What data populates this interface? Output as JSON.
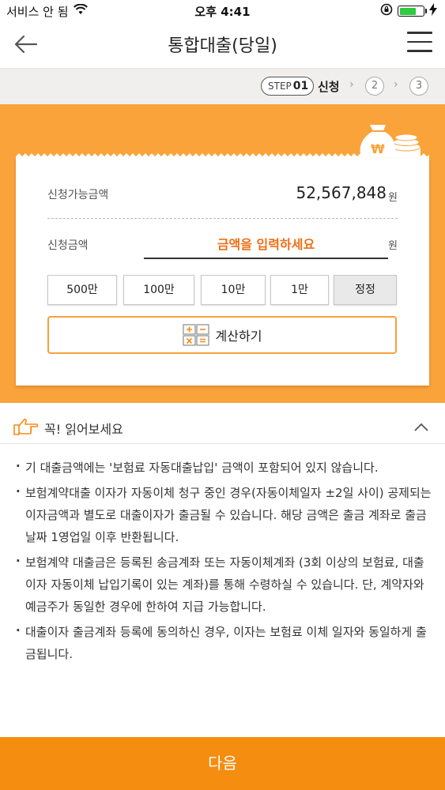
{
  "status_bar": {
    "carrier": "서비스 안 됨",
    "time": "오후 4:41"
  },
  "header": {
    "title": "통합대출(당일)"
  },
  "steps": {
    "step_prefix": "STEP",
    "current_number": "01",
    "current_label": "신청",
    "step2": "2",
    "step3": "3"
  },
  "form": {
    "available_label": "신청가능금액",
    "available_amount": "52,567,848",
    "available_unit": "원",
    "apply_label": "신청금액",
    "apply_placeholder": "금액을 입력하세요",
    "apply_unit": "원",
    "amount_buttons": [
      "500만",
      "100만",
      "10만",
      "1만",
      "정정"
    ],
    "calc_label": "계산하기"
  },
  "notice": {
    "title": "꼭! 읽어보세요",
    "items": [
      "기 대출금액에는 '보험료 자동대출납입' 금액이 포함되어 있지 않습니다.",
      "보험계약대출 이자가 자동이체 청구 중인 경우(자동이체일자 ±2일 사이) 공제되는 이자금액과 별도로 대출이자가 출금될 수 있습니다. 해당 금액은 출금 계좌로 출금날짜 1영업일 이후 반환됩니다.",
      "보험계약 대출금은 등록된 송금계좌 또는 자동이체계좌 (3회 이상의 보험료, 대출이자 자동이체 납입기록이 있는 계좌)를 통해 수령하실 수 있습니다. 단, 계약자와 예금주가 동일한 경우에 한하여 지급 가능합니다.",
      "대출이자 출금계좌 등록에 동의하신 경우, 이자는 보험료 이체 일자와 동일하게 출금됩니다."
    ]
  },
  "footer": {
    "next_label": "다음"
  },
  "colors": {
    "accent": "#f9a33a",
    "next_button": "#f58d10",
    "placeholder": "#ee6f17"
  },
  "icons": [
    "wifi-icon",
    "lock-rotation-icon",
    "battery-icon",
    "charging-icon",
    "back-arrow-icon",
    "hamburger-menu-icon",
    "money-bag-icon",
    "calculator-icon",
    "pointing-hand-icon",
    "chevron-up-icon"
  ]
}
